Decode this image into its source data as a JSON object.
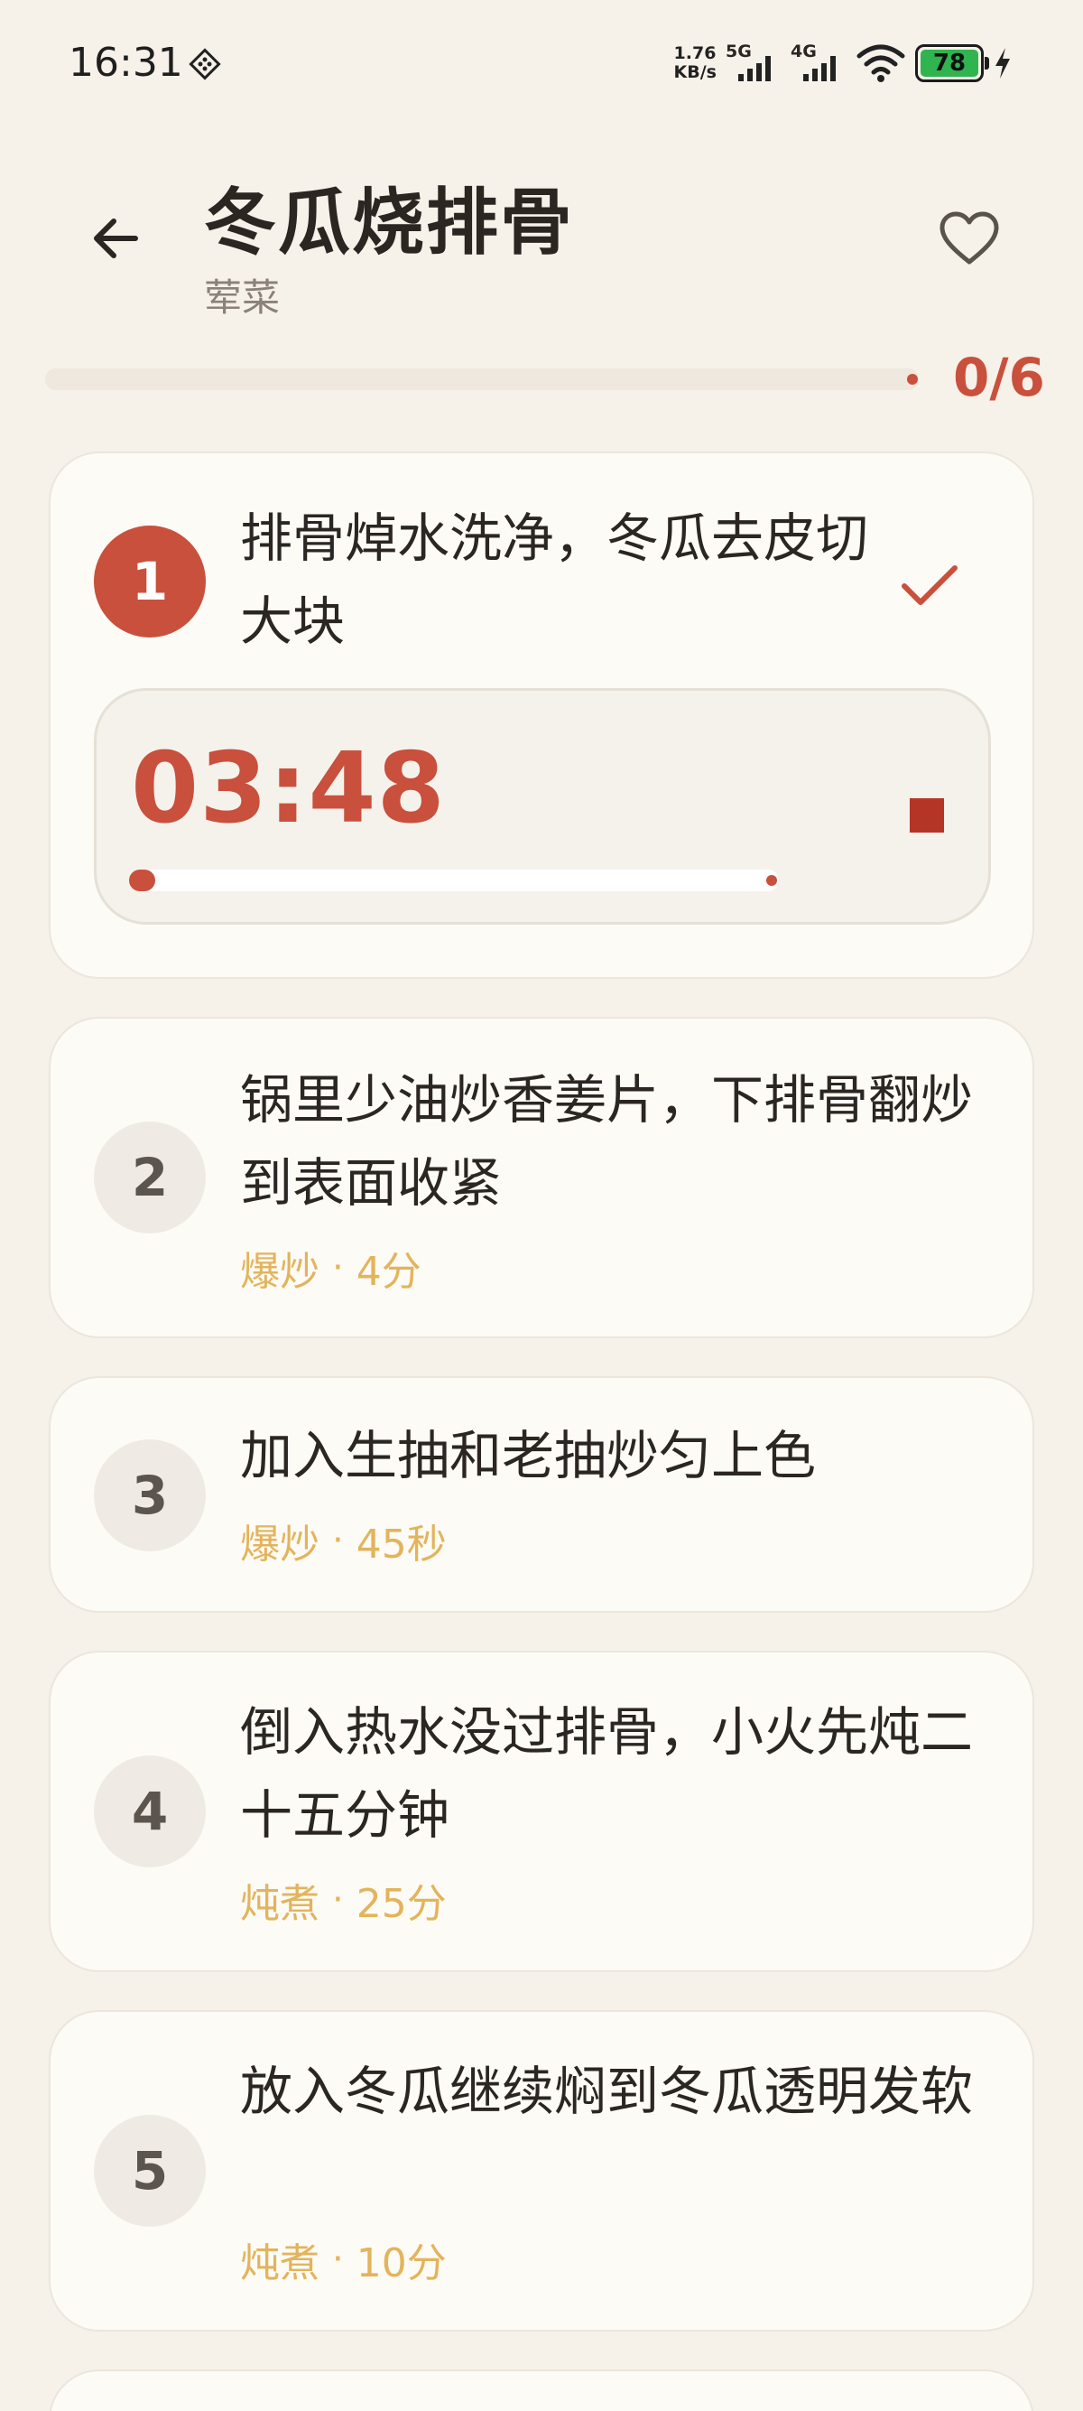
{
  "status_bar": {
    "time": "16:31",
    "speed_value": "1.76",
    "speed_unit": "KB/s",
    "net1": "5G",
    "net2": "4G",
    "battery": "78",
    "icons": [
      "app-notification-icon",
      "signal-icon",
      "wifi-icon",
      "battery-icon",
      "charging-icon"
    ]
  },
  "header": {
    "title": "冬瓜烧排骨",
    "subtitle": "荤菜",
    "back_icon": "arrow-left-icon",
    "favorite_icon": "heart-outline-icon"
  },
  "progress": {
    "label": "0/6",
    "completed": 0,
    "total": 6
  },
  "colors": {
    "accent": "#C9503C",
    "meta": "#E3B45C",
    "background": "#F6F1E9",
    "card": "#FDFBF6"
  },
  "steps": [
    {
      "number": "1",
      "text": "排骨焯水洗净，冬瓜去皮切大块",
      "active": true,
      "timer": {
        "value": "03:48",
        "progress": 0.04,
        "stop_icon": "stop-icon"
      },
      "check_icon": "check-icon"
    },
    {
      "number": "2",
      "text": "锅里少油炒香姜片，下排骨翻炒到表面收紧",
      "method": "爆炒",
      "separator": "·",
      "duration": "4分"
    },
    {
      "number": "3",
      "text": "加入生抽和老抽炒匀上色",
      "method": "爆炒",
      "separator": "·",
      "duration": "45秒"
    },
    {
      "number": "4",
      "text": "倒入热水没过排骨，小火先炖二十五分钟",
      "method": "炖煮",
      "separator": "·",
      "duration": "25分"
    },
    {
      "number": "5",
      "text": "放入冬瓜继续焖到冬瓜透明发软",
      "method": "炖煮",
      "separator": "·",
      "duration": "10分"
    }
  ]
}
